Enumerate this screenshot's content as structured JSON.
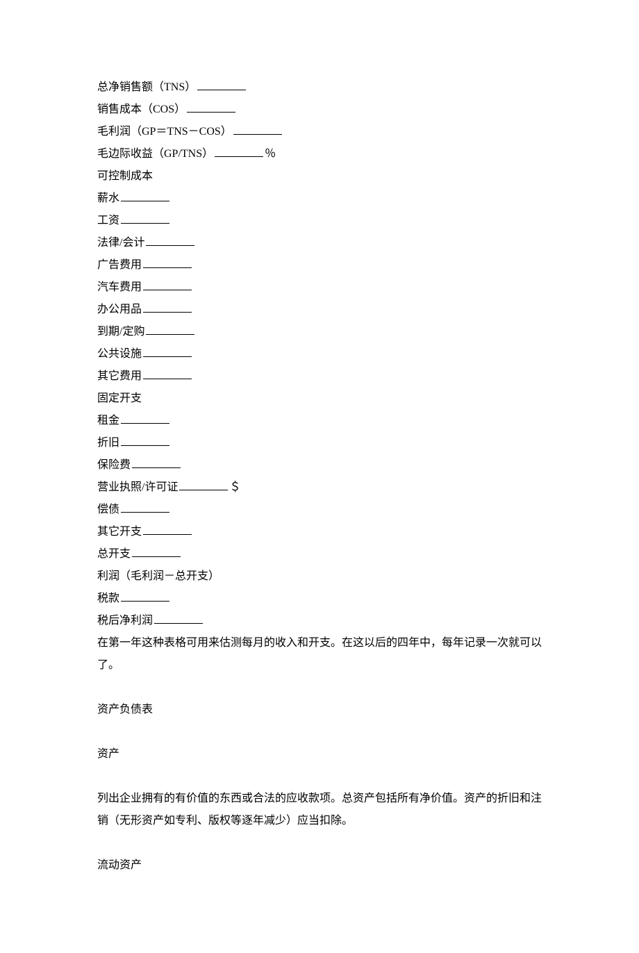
{
  "l1_a": "总净销售额（TNS）",
  "l2_a": "销售成本（COS）",
  "l3_a": "毛利润（GP＝TNS－COS）",
  "l4_a": "毛边际收益（GP/TNS）",
  "l4_b": "％",
  "l5": "可控制成本",
  "l6": "薪水",
  "l7": "工资",
  "l8": "法律/会计",
  "l9": "广告费用",
  "l10": "汽车费用",
  "l11": "办公用品",
  "l12": "到期/定购",
  "l13": "公共设施",
  "l14": "其它费用",
  "l15": "固定开支",
  "l16": "租金",
  "l17": "折旧",
  "l18": "保险费",
  "l19_a": "营业执照/许可证",
  "l19_b": "＄",
  "l20": "偿债",
  "l21": "其它开支",
  "l22": "总开支",
  "l23": "利润（毛利润－总开支）",
  "l24": "税款",
  "l25": "税后净利润",
  "p1": "在第一年这种表格可用来估测每月的收入和开支。在这以后的四年中，每年记录一次就可以了。",
  "h1": "资产负债表",
  "h2": "资产",
  "p2": "列出企业拥有的有价值的东西或合法的应收款项。总资产包括所有净价值。资产的折旧和注销（无形资产如专利、版权等逐年减少）应当扣除。",
  "h3": "流动资产"
}
